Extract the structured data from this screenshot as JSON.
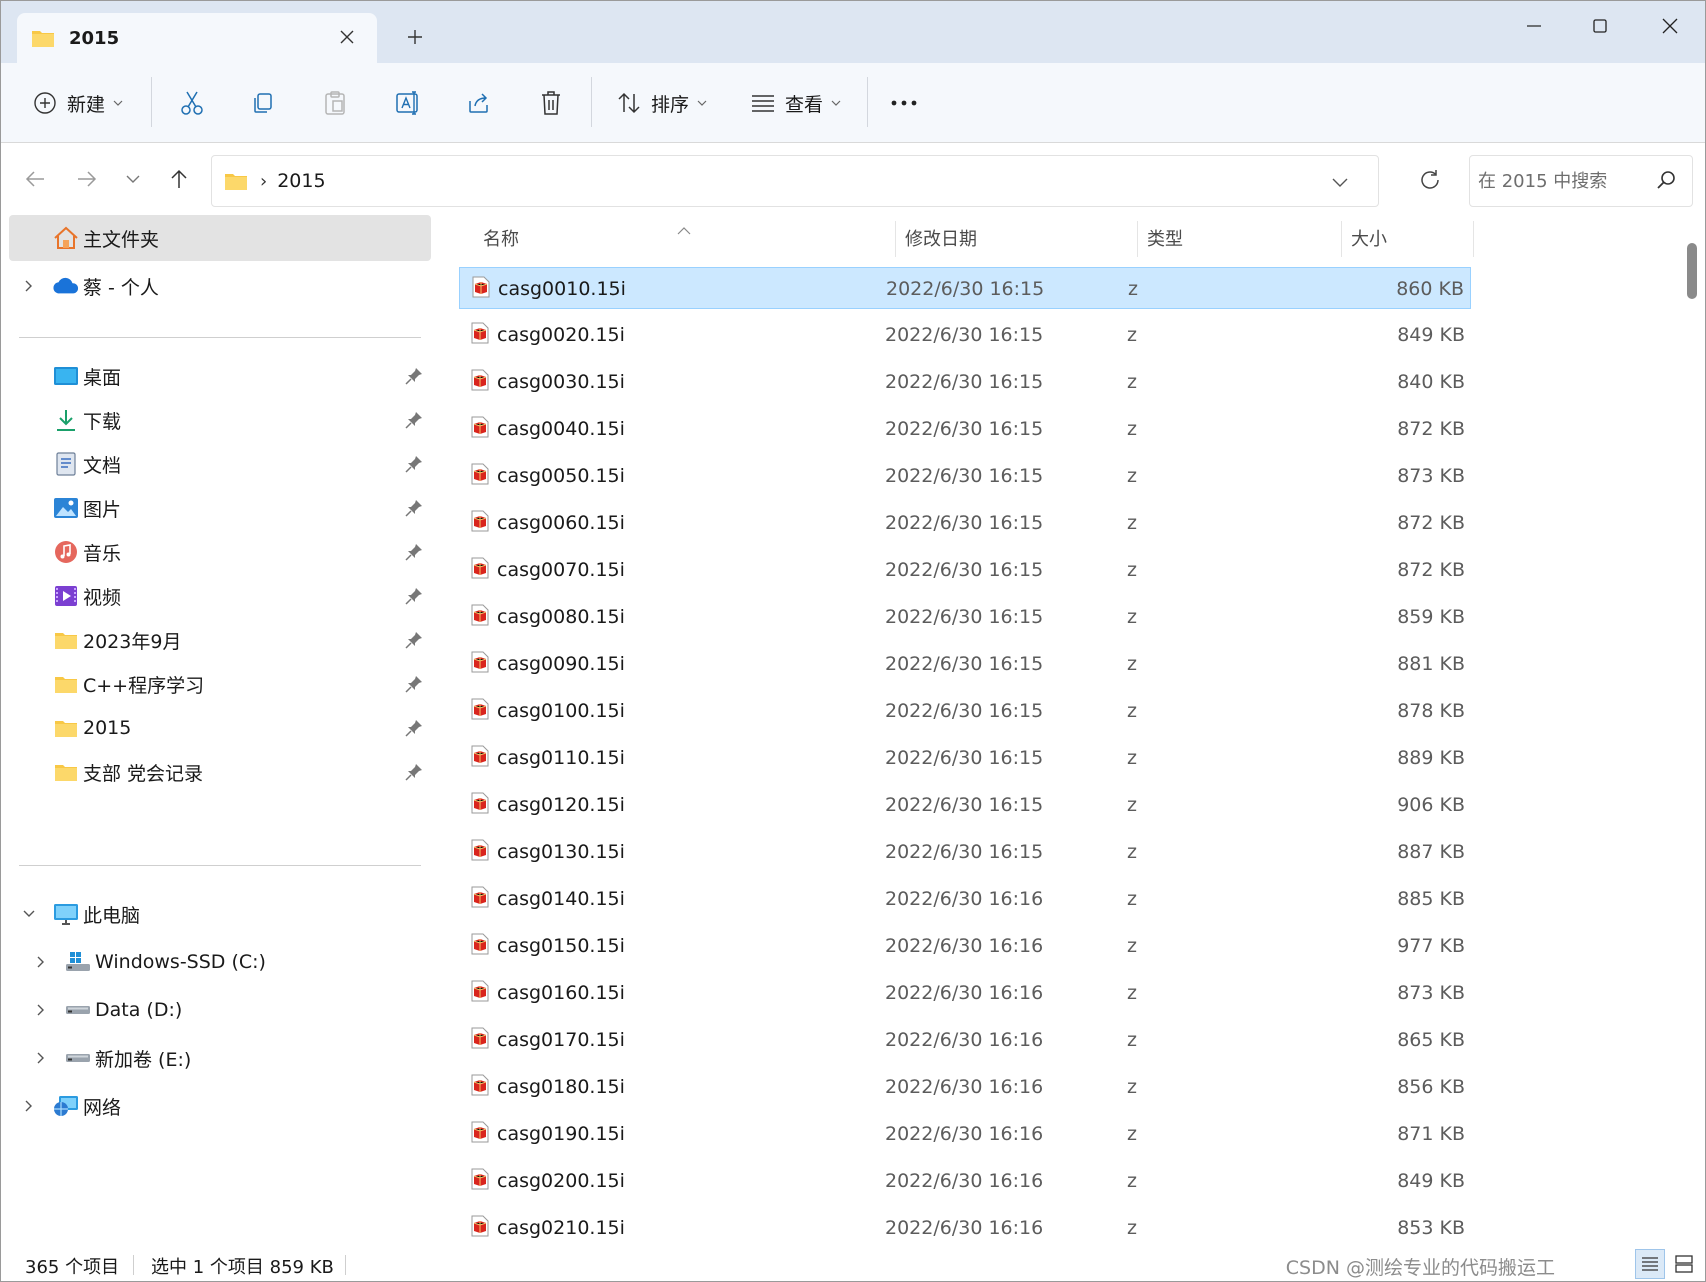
{
  "tab": {
    "title": "2015"
  },
  "toolbar": {
    "new_label": "新建",
    "sort_label": "排序",
    "view_label": "查看"
  },
  "address": {
    "crumb": "2015"
  },
  "search": {
    "placeholder": "在 2015 中搜索"
  },
  "sidebar": {
    "home": "主文件夹",
    "onedrive": "蔡 - 个人",
    "quick": [
      {
        "label": "桌面",
        "icon": "desktop-icon"
      },
      {
        "label": "下载",
        "icon": "download-icon"
      },
      {
        "label": "文档",
        "icon": "documents-icon"
      },
      {
        "label": "图片",
        "icon": "pictures-icon"
      },
      {
        "label": "音乐",
        "icon": "music-icon"
      },
      {
        "label": "视频",
        "icon": "videos-icon"
      },
      {
        "label": "2023年9月",
        "icon": "folder-icon"
      },
      {
        "label": "C++程序学习",
        "icon": "folder-icon"
      },
      {
        "label": "2015",
        "icon": "folder-icon"
      },
      {
        "label": "支部 党会记录",
        "icon": "folder-icon"
      }
    ],
    "this_pc": "此电脑",
    "drives": [
      {
        "label": "Windows-SSD (C:)",
        "icon": "windows-drive-icon"
      },
      {
        "label": "Data (D:)",
        "icon": "drive-icon"
      },
      {
        "label": "新加卷 (E:)",
        "icon": "drive-icon"
      }
    ],
    "network": "网络"
  },
  "columns": {
    "name": "名称",
    "date": "修改日期",
    "type": "类型",
    "size": "大小"
  },
  "files": [
    {
      "name": "casg0010.15i",
      "date": "2022/6/30 16:15",
      "type": "z",
      "size": "860 KB"
    },
    {
      "name": "casg0020.15i",
      "date": "2022/6/30 16:15",
      "type": "z",
      "size": "849 KB"
    },
    {
      "name": "casg0030.15i",
      "date": "2022/6/30 16:15",
      "type": "z",
      "size": "840 KB"
    },
    {
      "name": "casg0040.15i",
      "date": "2022/6/30 16:15",
      "type": "z",
      "size": "872 KB"
    },
    {
      "name": "casg0050.15i",
      "date": "2022/6/30 16:15",
      "type": "z",
      "size": "873 KB"
    },
    {
      "name": "casg0060.15i",
      "date": "2022/6/30 16:15",
      "type": "z",
      "size": "872 KB"
    },
    {
      "name": "casg0070.15i",
      "date": "2022/6/30 16:15",
      "type": "z",
      "size": "872 KB"
    },
    {
      "name": "casg0080.15i",
      "date": "2022/6/30 16:15",
      "type": "z",
      "size": "859 KB"
    },
    {
      "name": "casg0090.15i",
      "date": "2022/6/30 16:15",
      "type": "z",
      "size": "881 KB"
    },
    {
      "name": "casg0100.15i",
      "date": "2022/6/30 16:15",
      "type": "z",
      "size": "878 KB"
    },
    {
      "name": "casg0110.15i",
      "date": "2022/6/30 16:15",
      "type": "z",
      "size": "889 KB"
    },
    {
      "name": "casg0120.15i",
      "date": "2022/6/30 16:15",
      "type": "z",
      "size": "906 KB"
    },
    {
      "name": "casg0130.15i",
      "date": "2022/6/30 16:15",
      "type": "z",
      "size": "887 KB"
    },
    {
      "name": "casg0140.15i",
      "date": "2022/6/30 16:16",
      "type": "z",
      "size": "885 KB"
    },
    {
      "name": "casg0150.15i",
      "date": "2022/6/30 16:16",
      "type": "z",
      "size": "977 KB"
    },
    {
      "name": "casg0160.15i",
      "date": "2022/6/30 16:16",
      "type": "z",
      "size": "873 KB"
    },
    {
      "name": "casg0170.15i",
      "date": "2022/6/30 16:16",
      "type": "z",
      "size": "865 KB"
    },
    {
      "name": "casg0180.15i",
      "date": "2022/6/30 16:16",
      "type": "z",
      "size": "856 KB"
    },
    {
      "name": "casg0190.15i",
      "date": "2022/6/30 16:16",
      "type": "z",
      "size": "871 KB"
    },
    {
      "name": "casg0200.15i",
      "date": "2022/6/30 16:16",
      "type": "z",
      "size": "849 KB"
    },
    {
      "name": "casg0210.15i",
      "date": "2022/6/30 16:16",
      "type": "z",
      "size": "853 KB"
    }
  ],
  "status": {
    "count": "365 个项目",
    "selection": "选中 1 个项目  859 KB"
  },
  "watermark": "CSDN @测绘专业的代码搬运工",
  "colors": {
    "accent": "#0067c0",
    "selection_bg": "#cce8ff",
    "selection_border": "#99d1ff",
    "folder": "#f8c846",
    "file_icon": "#d9251d"
  }
}
